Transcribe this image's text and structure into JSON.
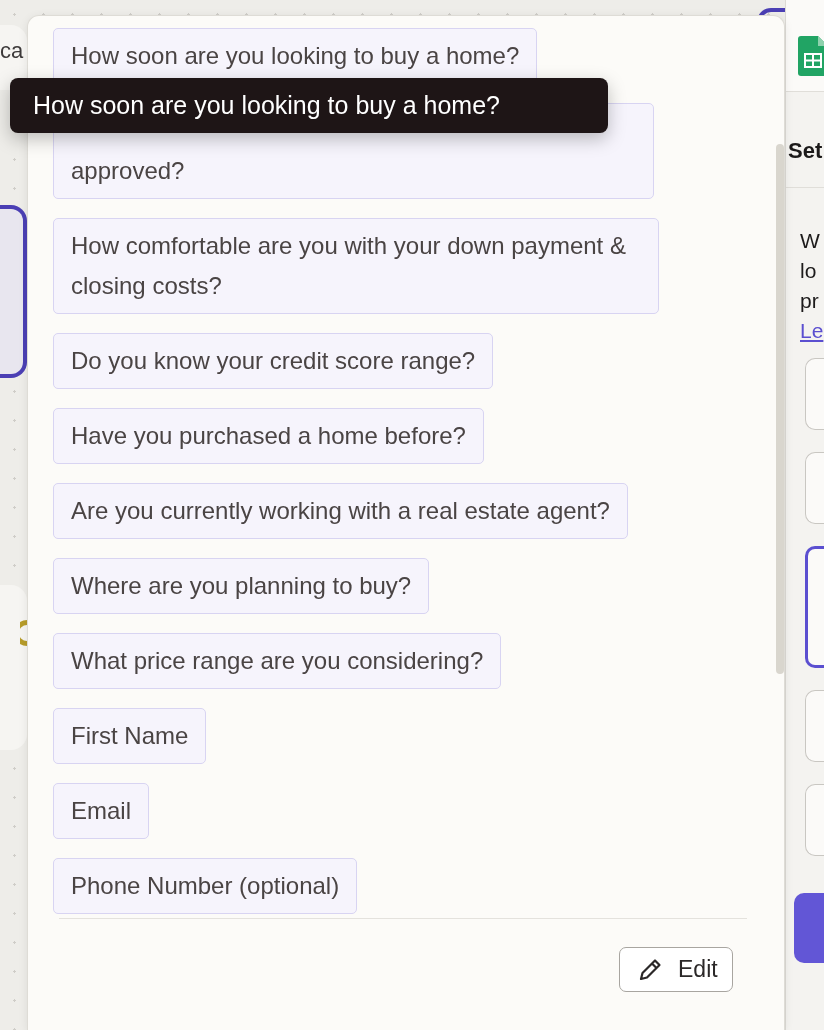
{
  "canvas": {
    "label": "ca"
  },
  "side_panel": {
    "heading": "Set",
    "lines": [
      "W",
      "lo",
      "pr"
    ],
    "link": "Le",
    "options": [
      {
        "selected": false
      },
      {
        "selected": false
      },
      {
        "selected": true
      },
      {
        "selected": false
      },
      {
        "selected": false
      }
    ]
  },
  "questions": [
    {
      "label": "How soon are you looking to buy a home?"
    },
    {
      "label": "approved?",
      "kind": "covered"
    },
    {
      "label": "How comfortable are you with your down payment & closing costs?"
    },
    {
      "label": "Do you know your credit score range?"
    },
    {
      "label": "Have you purchased a home before?"
    },
    {
      "label": "Are you currently working with a real estate agent?"
    },
    {
      "label": "Where are you planning to buy?"
    },
    {
      "label": "What price range are you considering?"
    },
    {
      "label": "First Name"
    },
    {
      "label": "Email"
    },
    {
      "label": "Phone Number (optional)"
    }
  ],
  "tooltip": {
    "text": "How soon are you looking to buy a home?"
  },
  "edit_button": {
    "label": "Edit"
  }
}
